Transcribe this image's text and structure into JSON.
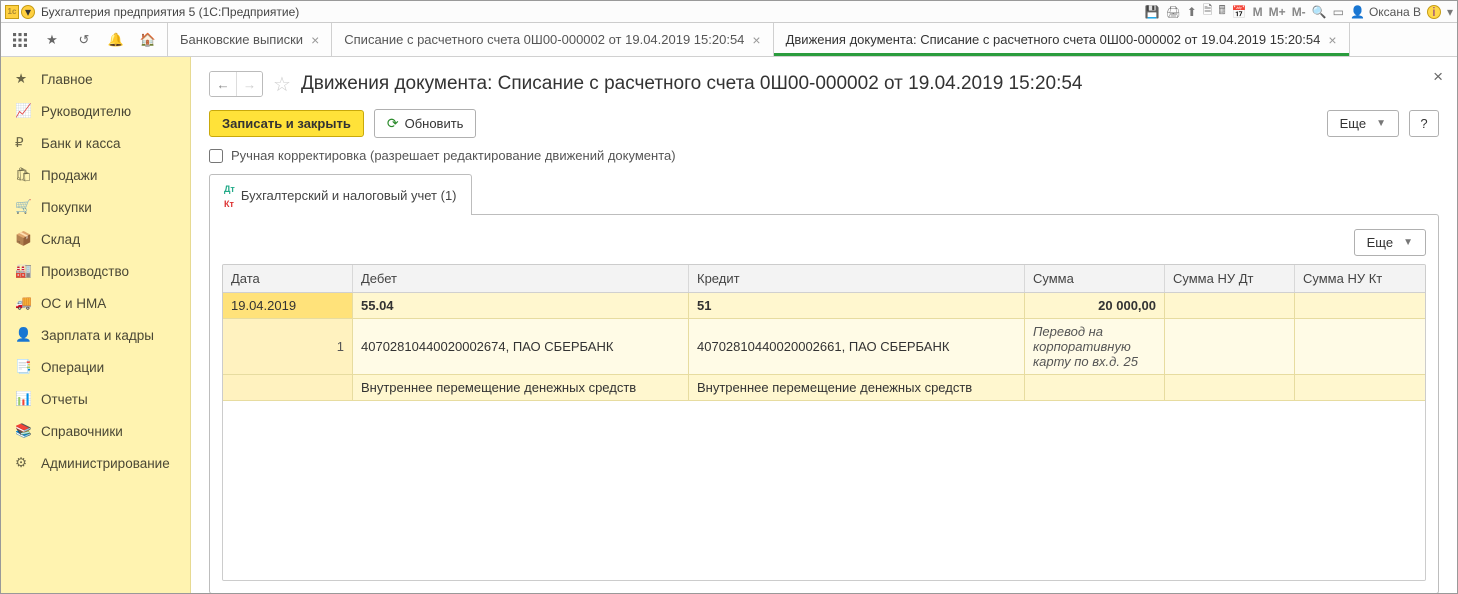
{
  "titlebar": {
    "app_title": "Бухгалтерия предприятия 5   (1С:Предприятие)",
    "user": "Оксана В",
    "m_icons": [
      "M",
      "M+",
      "M-"
    ]
  },
  "tabs": [
    {
      "label": "Банковские выписки",
      "active": false
    },
    {
      "label": "Списание с расчетного счета 0Ш00-000002 от 19.04.2019 15:20:54",
      "active": false
    },
    {
      "label": "Движения документа: Списание с расчетного счета 0Ш00-000002 от 19.04.2019 15:20:54",
      "active": true
    }
  ],
  "sidebar": {
    "items": [
      "Главное",
      "Руководителю",
      "Банк и касса",
      "Продажи",
      "Покупки",
      "Склад",
      "Производство",
      "ОС и НМА",
      "Зарплата и кадры",
      "Операции",
      "Отчеты",
      "Справочники",
      "Администрирование"
    ]
  },
  "page": {
    "title": "Движения документа: Списание с расчетного счета 0Ш00-000002 от 19.04.2019 15:20:54",
    "save_close": "Записать и закрыть",
    "refresh": "Обновить",
    "more": "Еще",
    "help": "?",
    "manual_label": "Ручная корректировка (разрешает редактирование движений документа)",
    "tab_label": "Бухгалтерский и налоговый учет (1)"
  },
  "grid": {
    "headers": {
      "date": "Дата",
      "debit": "Дебет",
      "credit": "Кредит",
      "sum": "Сумма",
      "nudt": "Сумма НУ Дт",
      "nukt": "Сумма НУ Кт"
    },
    "row": {
      "date": "19.04.2019",
      "n": "1",
      "debit_acc": "55.04",
      "credit_acc": "51",
      "sum": "20 000,00",
      "debit_sub": "40702810440020002674, ПАО СБЕРБАНК",
      "credit_sub": "40702810440020002661, ПАО СБЕРБАНК",
      "sum_note": "Перевод на корпоративную карту по вх.д. 25",
      "debit_note": "Внутреннее перемещение денежных средств",
      "credit_note": "Внутреннее перемещение денежных средств"
    }
  }
}
